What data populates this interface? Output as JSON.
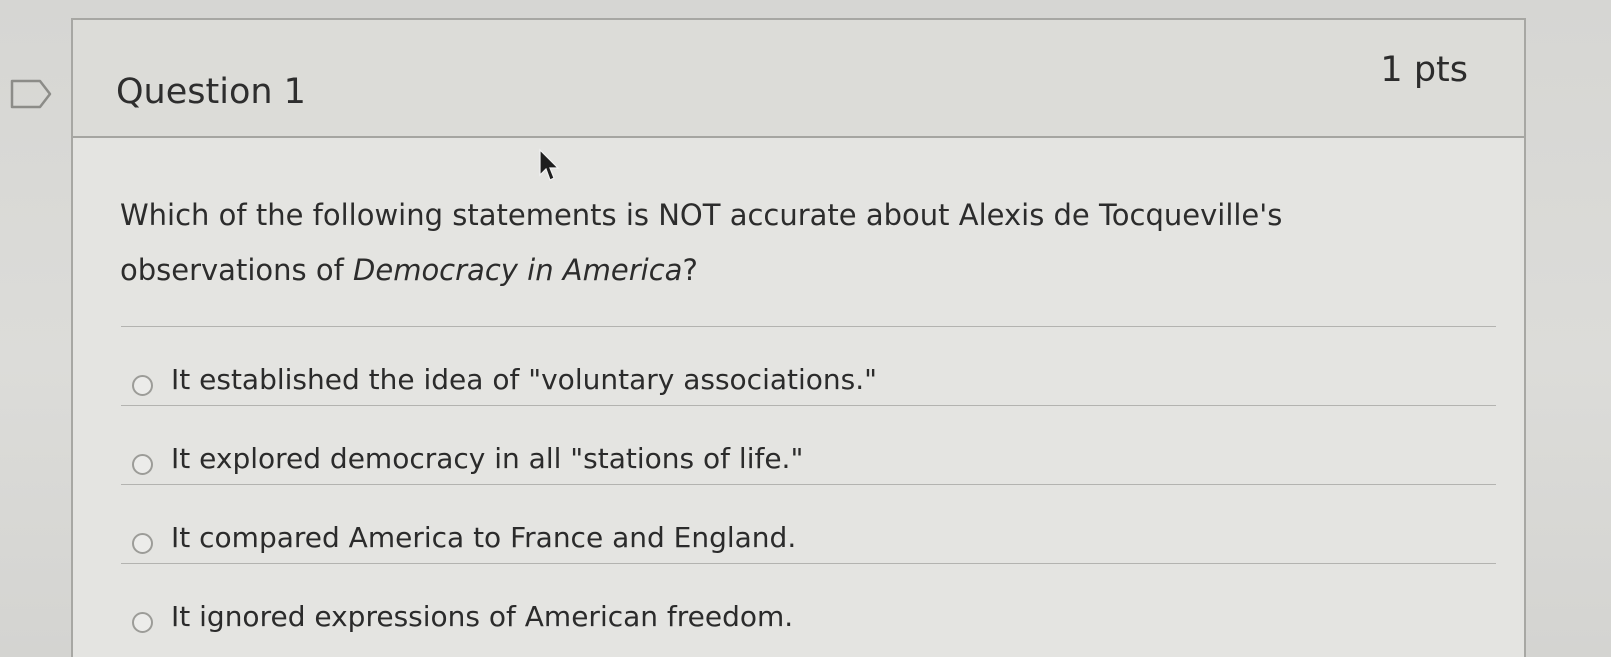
{
  "question": {
    "title": "Question 1",
    "points": "1 pts",
    "text_before_italic": "Which of the following statements is NOT accurate about Alexis de Tocqueville's observations of ",
    "text_italic": "Democracy in America",
    "text_after_italic": "?"
  },
  "answers": [
    {
      "label": "It established the idea of \"voluntary associations.\"",
      "selected": false
    },
    {
      "label": "It explored democracy in all \"stations of life.\"",
      "selected": false
    },
    {
      "label": "It compared America to France and England.",
      "selected": false
    },
    {
      "label": "It ignored expressions of American freedom.",
      "selected": false
    }
  ],
  "icons": {
    "flag": "flag-question-icon",
    "cursor": "mouse-pointer-icon"
  },
  "colors": {
    "border": "#a7a7a3",
    "text": "#2c2c2c",
    "header_bg": "#dcdcd8"
  }
}
